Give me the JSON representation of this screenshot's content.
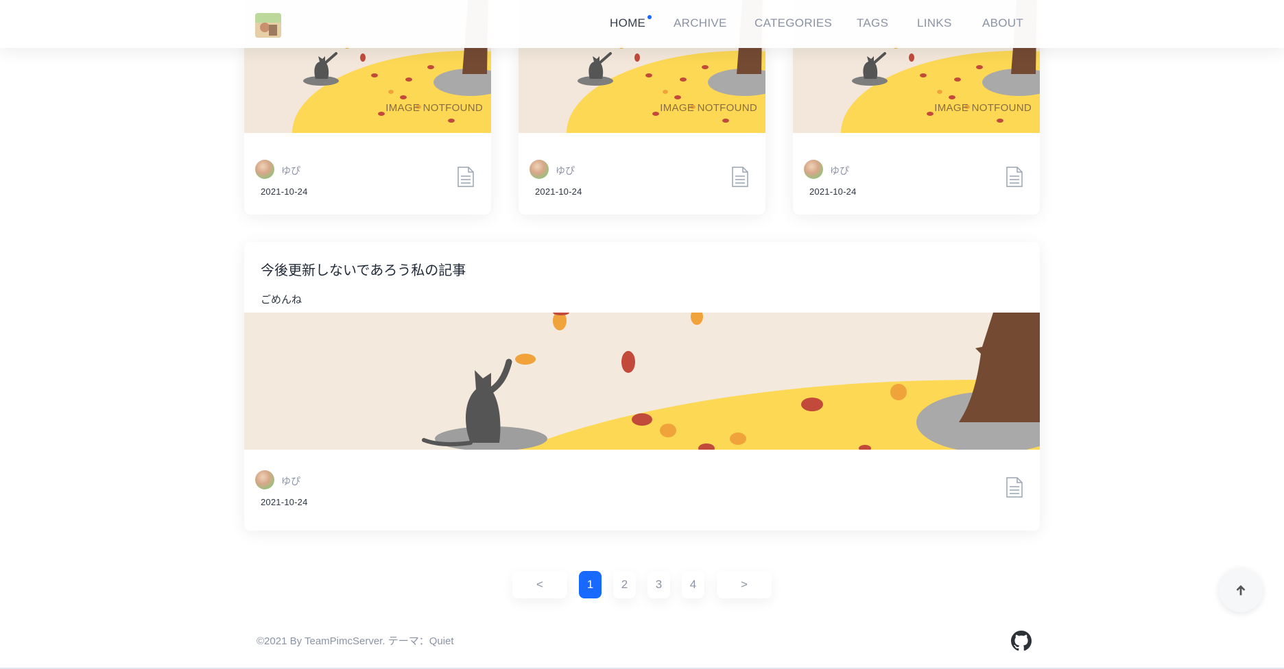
{
  "header": {
    "logo_alt": "site logo",
    "nav": [
      {
        "label": "HOME",
        "active": true
      },
      {
        "label": "ARCHIVE",
        "active": false
      },
      {
        "label": "CATEGORIES",
        "active": false
      },
      {
        "label": "TAGS",
        "active": false
      },
      {
        "label": "LINKS",
        "active": false
      },
      {
        "label": "ABOUT",
        "active": false
      }
    ]
  },
  "posts_row": [
    {
      "thumb_text": "IMAGE NOTFOUND",
      "author": "ゆぴ",
      "date": "2021-10-24",
      "icon": "document-icon"
    },
    {
      "thumb_text": "IMAGE NOTFOUND",
      "author": "ゆぴ",
      "date": "2021-10-24",
      "icon": "document-icon"
    },
    {
      "thumb_text": "IMAGE NOTFOUND",
      "author": "ゆぴ",
      "date": "2021-10-24",
      "icon": "document-icon"
    }
  ],
  "featured_post": {
    "title": "今後更新しないであろう私の記事",
    "excerpt": "ごめんね",
    "author": "ゆぴ",
    "date": "2021-10-24",
    "icon": "document-icon"
  },
  "pagination": {
    "prev_label": "<",
    "next_label": ">",
    "pages": [
      "1",
      "2",
      "3",
      "4"
    ],
    "current": "1"
  },
  "footer": {
    "copyright": "©2021 By TeamPimcServer. テーマ：Quiet",
    "icon": "github-icon"
  },
  "back_to_top_icon": "arrow-up-icon",
  "colors": {
    "accent": "#1769ff",
    "nav_text": "#8a93a4",
    "nav_active": "#36414f",
    "thumb_background": "#f3e9dc",
    "thumb_ground": "#fcd855",
    "cat": "#555555",
    "tree": "#744a32"
  }
}
